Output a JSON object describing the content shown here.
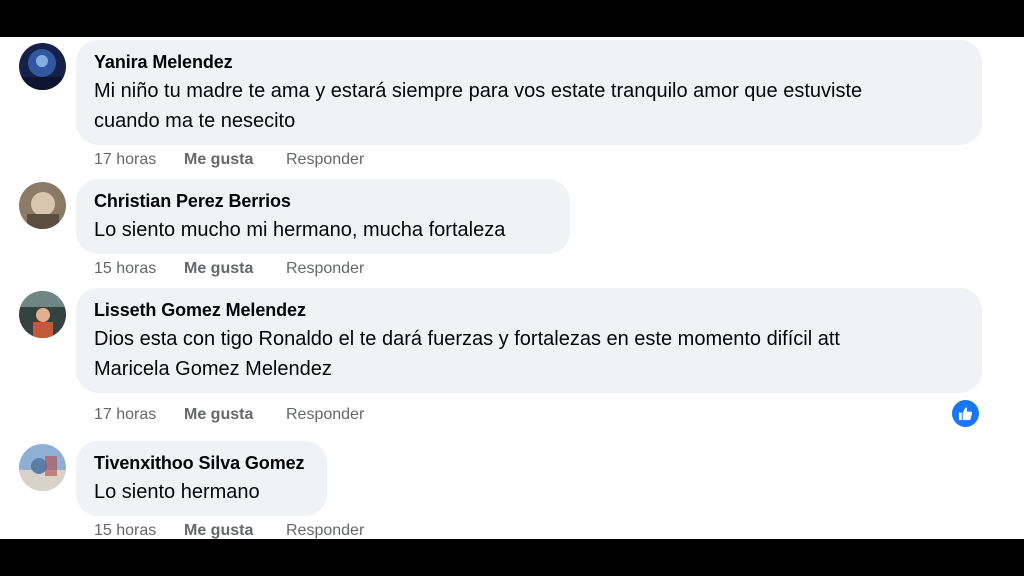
{
  "comments": [
    {
      "author": "Yanira Melendez",
      "text": "Mi niño tu madre te ama y estará siempre para vos estate tranquilo amor que estuviste\ncuando ma te nesecito",
      "time": "17 horas",
      "like_label": "Me gusta",
      "reply_label": "Responder",
      "avatar_colors": [
        "#1b2a5e",
        "#3d6fc4"
      ]
    },
    {
      "author": "Christian Perez Berrios",
      "text": "Lo siento mucho mi hermano, mucha fortaleza",
      "time": "15 horas",
      "like_label": "Me gusta",
      "reply_label": "Responder",
      "avatar_colors": [
        "#6b5a4a",
        "#c9b8a0"
      ]
    },
    {
      "author": "Lisseth Gomez Melendez",
      "text": "Dios esta con tigo Ronaldo el te dará fuerzas y fortalezas en este momento difícil att\nMaricela Gomez Melendez",
      "time": "17 horas",
      "like_label": "Me gusta",
      "reply_label": "Responder",
      "avatar_colors": [
        "#2e3b3a",
        "#c25a3a"
      ],
      "reaction": "like"
    },
    {
      "author": "Tivenxithoo Silva Gomez",
      "text": "Lo siento hermano",
      "time": "15 horas",
      "like_label": "Me gusta",
      "reply_label": "Responder",
      "avatar_colors": [
        "#5a7ea8",
        "#d9d2c8"
      ]
    }
  ],
  "colors": {
    "bubble": "#f0f2f5",
    "meta_text": "#65676b",
    "like_reaction": "#1877f2"
  },
  "icons": {
    "reaction": "thumbs-up-icon"
  }
}
